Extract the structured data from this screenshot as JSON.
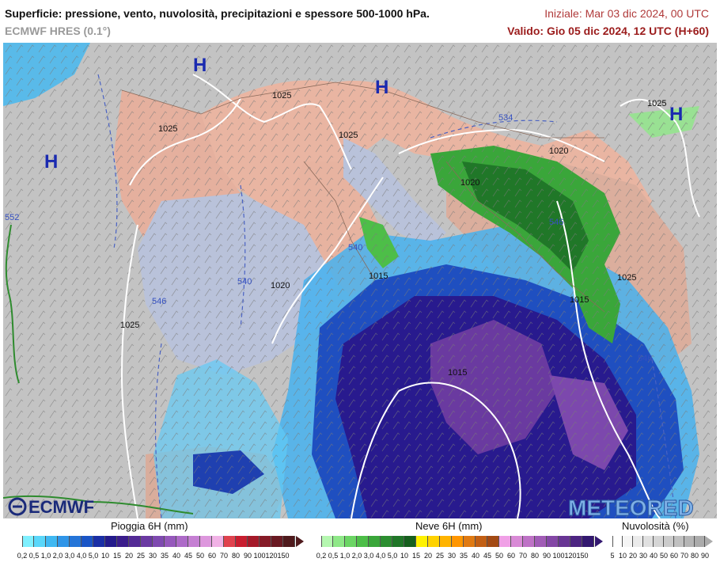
{
  "header": {
    "title": "Superficie: pressione, vento, nuvolosità, precipitazioni e spessore 500-1000 hPa.",
    "model": "ECMWF HRES (0.1°)",
    "init": "Iniziale: Mar 03 dic 2024, 00 UTC",
    "valid": "Valido: Gio 05 dic 2024, 12 UTC (H+60)"
  },
  "map": {
    "high_marker": "H",
    "isobar_labels": [
      "1025",
      "1025",
      "1025",
      "1025",
      "1020",
      "1020",
      "1015",
      "1015",
      "1015",
      "1025",
      "1020",
      "1025"
    ],
    "thickness_labels": [
      "534",
      "552",
      "546",
      "540",
      "540",
      "546",
      "546"
    ],
    "logos": {
      "ecmwf": "ECMWF",
      "meteored": "METEORED"
    }
  },
  "legend": {
    "rain": {
      "title": "Pioggia 6H (mm)",
      "ticks": [
        "0,2",
        "0,5",
        "1,0",
        "2,0",
        "3,0",
        "4,0",
        "5,0",
        "10",
        "15",
        "20",
        "25",
        "30",
        "35",
        "40",
        "45",
        "50",
        "60",
        "70",
        "80",
        "90",
        "100",
        "120",
        "150"
      ],
      "colors": [
        "#7ff0ff",
        "#5ad7fa",
        "#3fb8f2",
        "#2f95e8",
        "#2575d8",
        "#1a55c6",
        "#1a2fa6",
        "#241b8c",
        "#3b1d8c",
        "#532a96",
        "#6b3aa2",
        "#7f4ab0",
        "#9658bc",
        "#ad6ac8",
        "#c57fd3",
        "#dd97dd",
        "#f1b2e6",
        "#e0424e",
        "#c81e30",
        "#a51a2a",
        "#861b27",
        "#6a1a23",
        "#4f1a1d"
      ]
    },
    "snow": {
      "title": "Neve 6H (mm)",
      "ticks": [
        "0,2",
        "0,5",
        "1,0",
        "2,0",
        "3,0",
        "4,0",
        "5,0",
        "10",
        "15",
        "20",
        "25",
        "30",
        "35",
        "40",
        "45",
        "50",
        "60",
        "70",
        "80",
        "90",
        "100",
        "120",
        "150"
      ],
      "colors": [
        "#b5f7b0",
        "#8ee887",
        "#6bd564",
        "#4dbe48",
        "#3aa63a",
        "#2c8e30",
        "#207728",
        "#16601e",
        "#fff200",
        "#ffd200",
        "#ffb400",
        "#ff9600",
        "#e07a12",
        "#c25f14",
        "#a34a14",
        "#f0a0e6",
        "#d98ad6",
        "#be72c6",
        "#a15cb6",
        "#8447a6",
        "#683594",
        "#4d2582",
        "#331870"
      ]
    },
    "cloud": {
      "title": "Nuvolosità (%)",
      "ticks": [
        "5",
        "10",
        "20",
        "30",
        "40",
        "50",
        "60",
        "70",
        "80",
        "90"
      ],
      "colors": [
        "#ffffff",
        "#f5f5f5",
        "#ebebeb",
        "#e0e0e0",
        "#d5d5d5",
        "#cbcbcb",
        "#c0c0c0",
        "#b5b5b5",
        "#ababab"
      ]
    }
  }
}
